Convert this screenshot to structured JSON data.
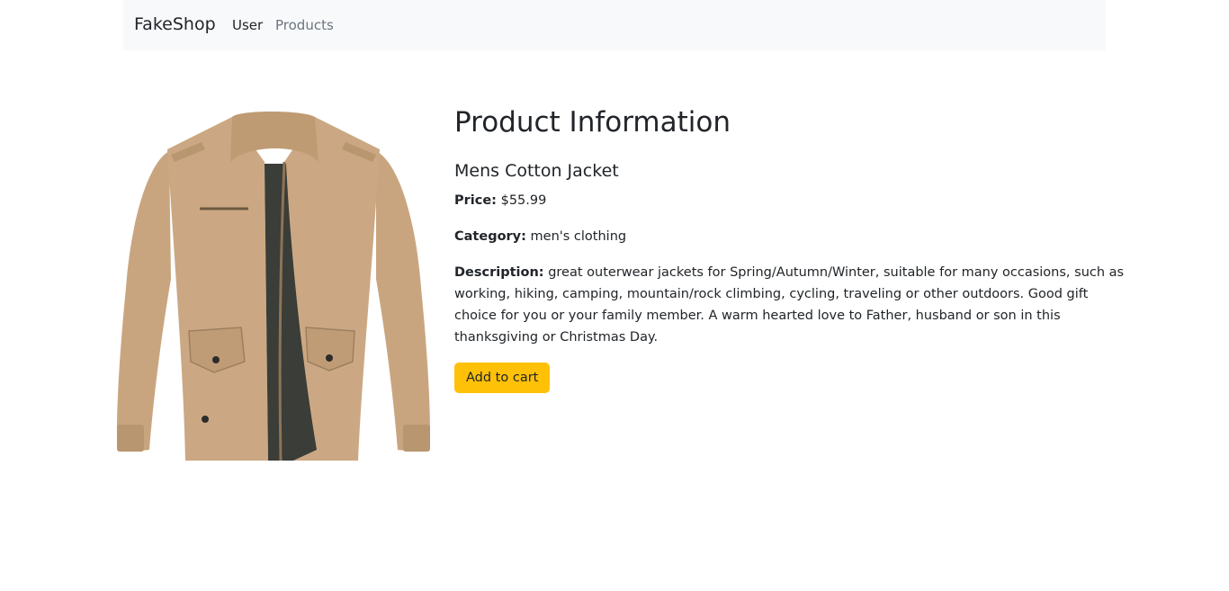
{
  "navbar": {
    "brand": "FakeShop",
    "links": [
      {
        "label": "User"
      },
      {
        "label": "Products"
      }
    ]
  },
  "product": {
    "heading": "Product Information",
    "name": "Mens Cotton Jacket",
    "price_label": "Price:",
    "price": "$55.99",
    "category_label": "Category:",
    "category": "men's clothing",
    "description_label": "Description:",
    "description": "great outerwear jackets for Spring/Autumn/Winter, suitable for many occasions, such as working, hiking, camping, mountain/rock climbing, cycling, traveling or other outdoors. Good gift choice for you or your family member. A warm hearted love to Father, husband or son in this thanksgiving or Christmas Day.",
    "add_to_cart": "Add to cart",
    "image_icon": "jacket-image"
  },
  "colors": {
    "navbar_bg": "#f8f9fa",
    "button": "#ffc107",
    "jacket": "#cba883",
    "lining": "#3a3d38"
  }
}
